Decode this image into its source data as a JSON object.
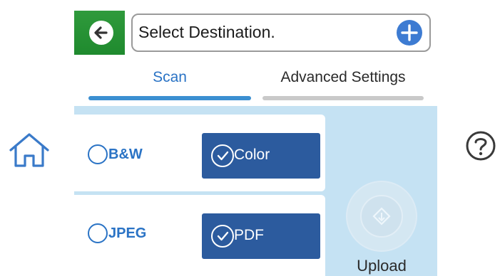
{
  "header": {
    "destination_placeholder": "Select Destination."
  },
  "tabs": [
    {
      "label": "Scan",
      "active": true
    },
    {
      "label": "Advanced Settings",
      "active": false
    }
  ],
  "settings": {
    "color_mode": {
      "option_bw": "B&W",
      "option_color": "Color",
      "selected": "Color"
    },
    "file_format": {
      "option_jpeg": "JPEG",
      "option_pdf": "PDF",
      "selected": "PDF"
    }
  },
  "upload": {
    "label": "Upload"
  },
  "colors": {
    "back_button": "#1f8a2e",
    "accent_blue": "#2a73c5",
    "selected_option": "#2c5b9e",
    "panel_background": "#c5e2f3"
  },
  "icons": [
    "back-arrow-icon",
    "add-icon",
    "home-icon",
    "help-icon",
    "start-scan-icon",
    "checkmark-icon"
  ]
}
